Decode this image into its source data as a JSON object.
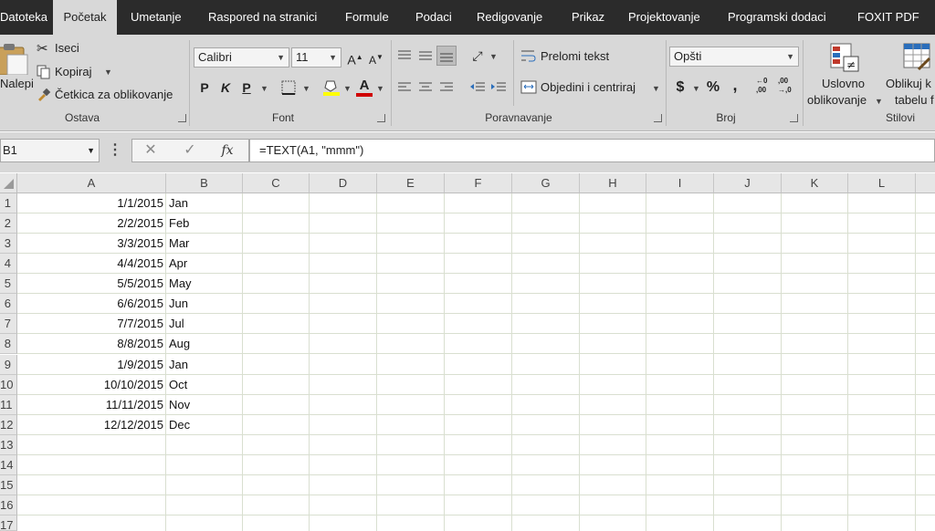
{
  "tabs": [
    {
      "label": "Datoteka",
      "active": false
    },
    {
      "label": "Početak",
      "active": true
    },
    {
      "label": "Umetanje",
      "active": false
    },
    {
      "label": "Raspored na stranici",
      "active": false
    },
    {
      "label": "Formule",
      "active": false
    },
    {
      "label": "Podaci",
      "active": false
    },
    {
      "label": "Redigovanje",
      "active": false
    },
    {
      "label": "Prikaz",
      "active": false
    },
    {
      "label": "Projektovanje",
      "active": false
    },
    {
      "label": "Programski dodaci",
      "active": false
    },
    {
      "label": "FOXIT PDF",
      "active": false
    }
  ],
  "clipboard": {
    "paste_label": "Nalepi",
    "cut_label": "Iseci",
    "copy_label": "Kopiraj",
    "format_painter_label": "Četkica za oblikovanje",
    "group_label": "Ostava"
  },
  "font": {
    "font_name": "Calibri",
    "font_size": "11",
    "bold": "P",
    "italic": "K",
    "underline": "P",
    "grow": "A",
    "shrink": "A",
    "font_color": "A",
    "group_label": "Font"
  },
  "alignment": {
    "wrap_label": "Prelomi tekst",
    "merge_label": "Objedini i centriraj",
    "group_label": "Poravnavanje"
  },
  "number": {
    "format": "Opšti",
    "currency": "$",
    "percent": "%",
    "comma": ",",
    "inc_decimal_top": "←0",
    "inc_decimal_bottom": ",00",
    "dec_decimal_top": ",00",
    "dec_decimal_bottom": "→,0",
    "group_label": "Broj"
  },
  "styles": {
    "conditional_line1": "Uslovno",
    "conditional_line2": "oblikovanje",
    "format_table_line1": "Oblikuj k",
    "format_table_line2": "tabelu f",
    "group_label": "Stilovi"
  },
  "formula_bar": {
    "name_box": "B1",
    "cancel": "✕",
    "enter": "✓",
    "fx": "fx",
    "formula": "=TEXT(A1, \"mmm\")"
  },
  "columns": [
    "A",
    "B",
    "C",
    "D",
    "E",
    "F",
    "G",
    "H",
    "I",
    "J",
    "K",
    "L"
  ],
  "rows": [
    {
      "num": "1",
      "a": "1/1/2015",
      "b": "Jan"
    },
    {
      "num": "2",
      "a": "2/2/2015",
      "b": "Feb"
    },
    {
      "num": "3",
      "a": "3/3/2015",
      "b": "Mar"
    },
    {
      "num": "4",
      "a": "4/4/2015",
      "b": "Apr"
    },
    {
      "num": "5",
      "a": "5/5/2015",
      "b": "May"
    },
    {
      "num": "6",
      "a": "6/6/2015",
      "b": "Jun"
    },
    {
      "num": "7",
      "a": "7/7/2015",
      "b": "Jul"
    },
    {
      "num": "8",
      "a": "8/8/2015",
      "b": "Aug"
    },
    {
      "num": "9",
      "a": "1/9/2015",
      "b": "Jan"
    },
    {
      "num": "10",
      "a": "10/10/2015",
      "b": "Oct"
    },
    {
      "num": "11",
      "a": "11/11/2015",
      "b": "Nov"
    },
    {
      "num": "12",
      "a": "12/12/2015",
      "b": "Dec"
    },
    {
      "num": "13",
      "a": "",
      "b": ""
    },
    {
      "num": "14",
      "a": "",
      "b": ""
    },
    {
      "num": "15",
      "a": "",
      "b": ""
    },
    {
      "num": "16",
      "a": "",
      "b": ""
    },
    {
      "num": "17",
      "a": "",
      "b": ""
    }
  ],
  "colors": {
    "tab_bar": "#2b2b2b",
    "ribbon": "#d8d8d8",
    "gridline": "#d9dfd0",
    "font_color_bar": "#d00000",
    "highlight_bar": "#ffff00"
  }
}
